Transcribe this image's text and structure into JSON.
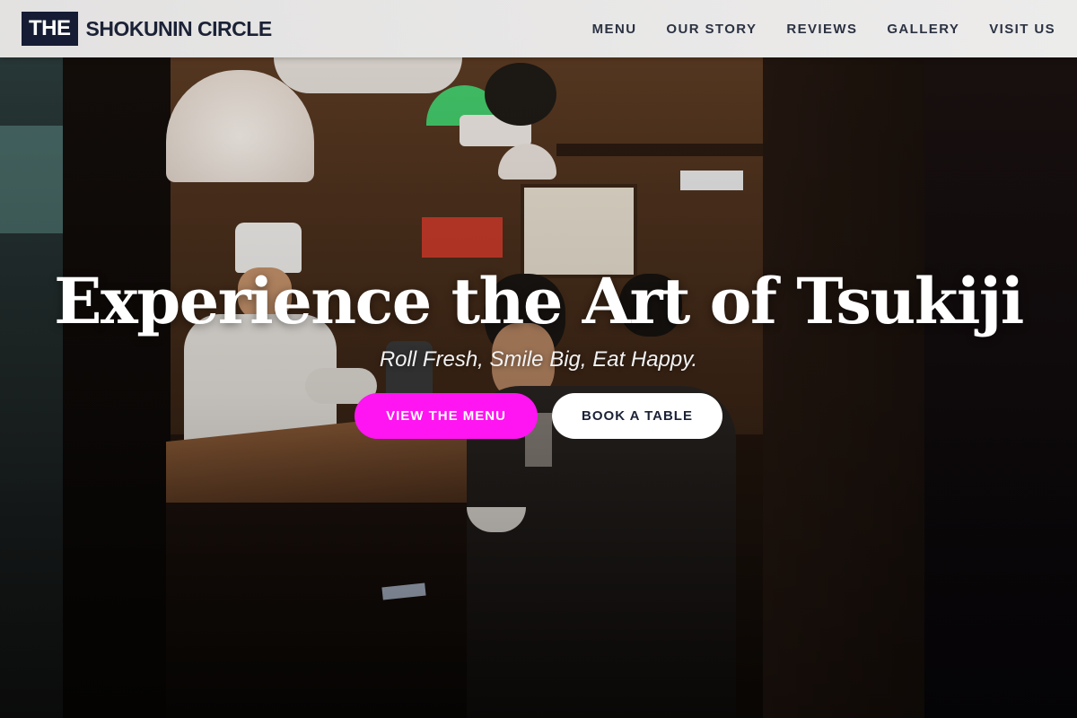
{
  "brand": {
    "logo_box_text": "THE",
    "logo_text": "SHOKUNIN CIRCLE"
  },
  "nav": {
    "items": [
      {
        "label": "MENU"
      },
      {
        "label": "OUR STORY"
      },
      {
        "label": "REVIEWS"
      },
      {
        "label": "GALLERY"
      },
      {
        "label": "VISIT US"
      }
    ]
  },
  "hero": {
    "title": "Experience the Art of Tsukiji",
    "subtitle": "Roll Fresh, Smile Big, Eat Happy.",
    "primary_button": "VIEW THE MENU",
    "secondary_button": "BOOK A TABLE"
  },
  "colors": {
    "accent": "#ff15f1",
    "brand_dark": "#151c33"
  }
}
